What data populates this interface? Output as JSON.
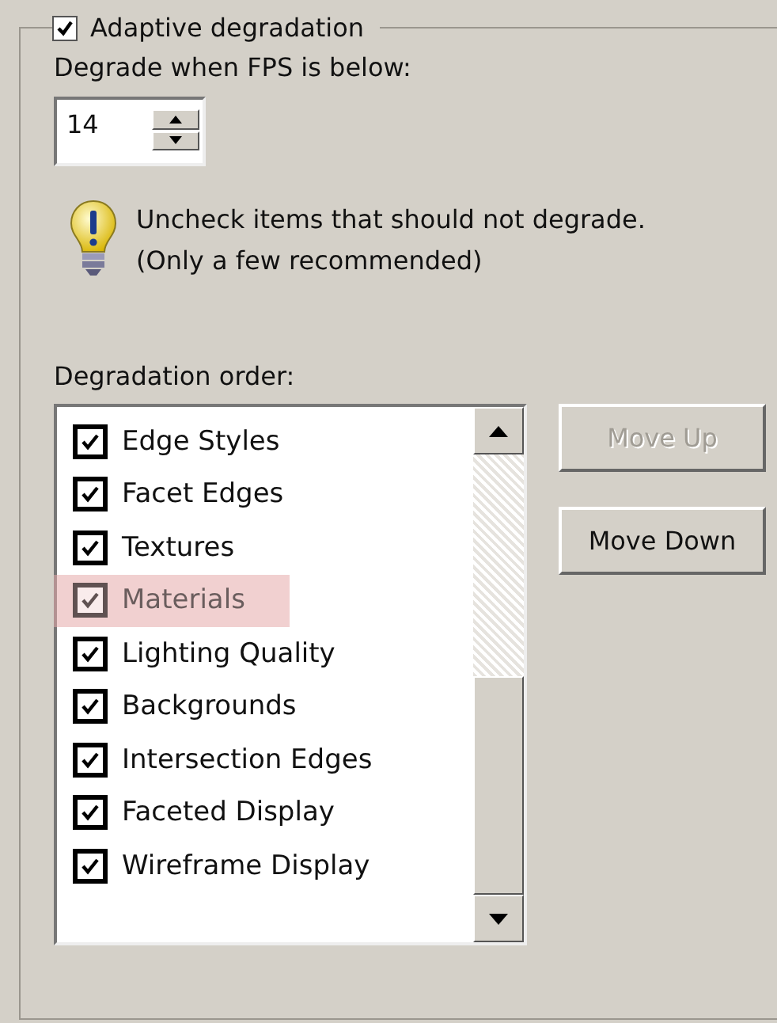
{
  "group": {
    "title": "Adaptive degradation",
    "checked": true
  },
  "threshold": {
    "label": "Degrade when FPS is below:",
    "value": "14"
  },
  "hint": {
    "lines": [
      "Uncheck items that should not degrade.",
      "(Only a few recommended)"
    ]
  },
  "order": {
    "label": "Degradation order:",
    "items": [
      {
        "label": "Edge Styles",
        "checked": true,
        "highlighted": false
      },
      {
        "label": "Facet Edges",
        "checked": true,
        "highlighted": false
      },
      {
        "label": "Textures",
        "checked": true,
        "highlighted": false
      },
      {
        "label": "Materials",
        "checked": true,
        "highlighted": true
      },
      {
        "label": "Lighting Quality",
        "checked": true,
        "highlighted": false
      },
      {
        "label": "Backgrounds",
        "checked": true,
        "highlighted": false
      },
      {
        "label": "Intersection Edges",
        "checked": true,
        "highlighted": false
      },
      {
        "label": "Faceted Display",
        "checked": true,
        "highlighted": false
      },
      {
        "label": "Wireframe Display",
        "checked": true,
        "highlighted": false
      }
    ]
  },
  "buttons": [
    {
      "label": "Move Up",
      "disabled": true
    },
    {
      "label": "Move Down",
      "disabled": false
    }
  ]
}
